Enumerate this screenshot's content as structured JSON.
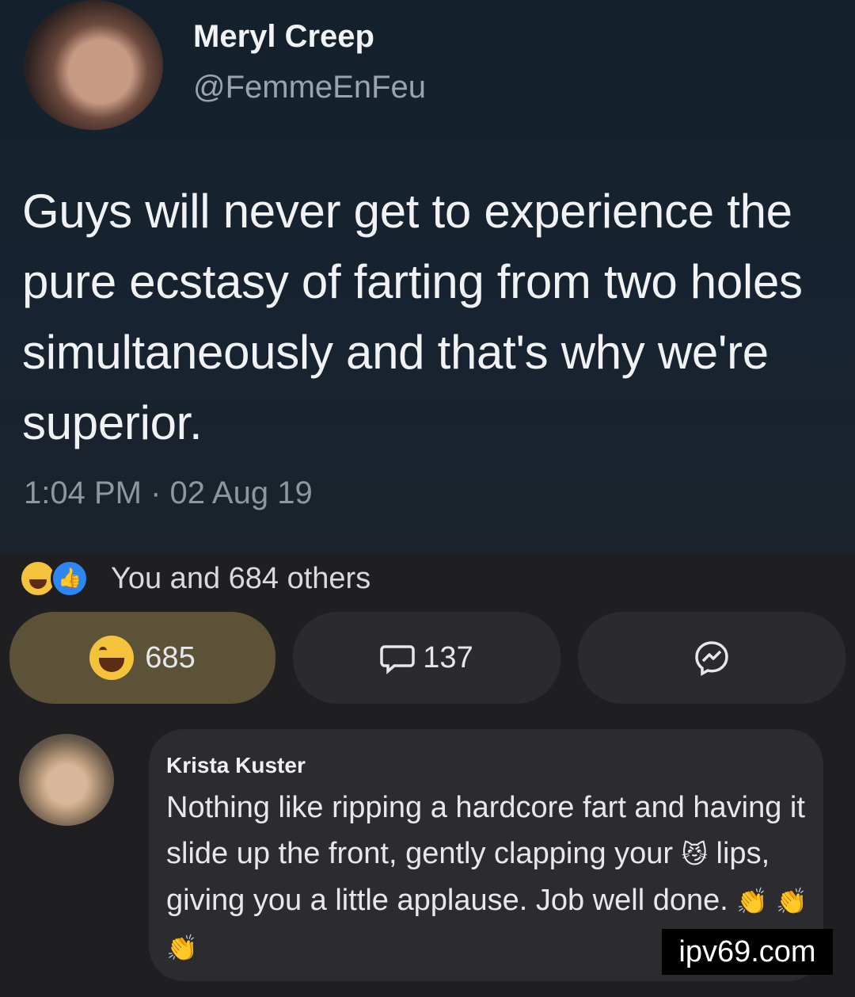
{
  "post": {
    "author_name": "Meryl Creep",
    "author_handle": "@FemmeEnFeu",
    "text": "Guys will never get to experience the pure ecstasy of farting from two holes simultaneously and that's why we're superior.",
    "timestamp": "1:04 PM · 02 Aug 19"
  },
  "reactions": {
    "summary": "You and 684 others",
    "icons": [
      "haha-icon",
      "like-icon"
    ]
  },
  "actions": {
    "haha_count": "685",
    "comment_count": "137",
    "share_icon": "messenger-icon"
  },
  "comment": {
    "author": "Krista Kuster",
    "text_part1": "Nothing like ripping a hardcore fart and having it slide up the front, gently clapping your",
    "emoji1": "😼",
    "text_part2": "lips, giving you a little applause. Job well done.",
    "emoji_claps": "👏 👏 👏"
  },
  "watermark": "ipv69.com",
  "colors": {
    "haha_button": "#5c5238",
    "button_bg": "#2b2b2f",
    "page_bg": "#1f1f22"
  }
}
